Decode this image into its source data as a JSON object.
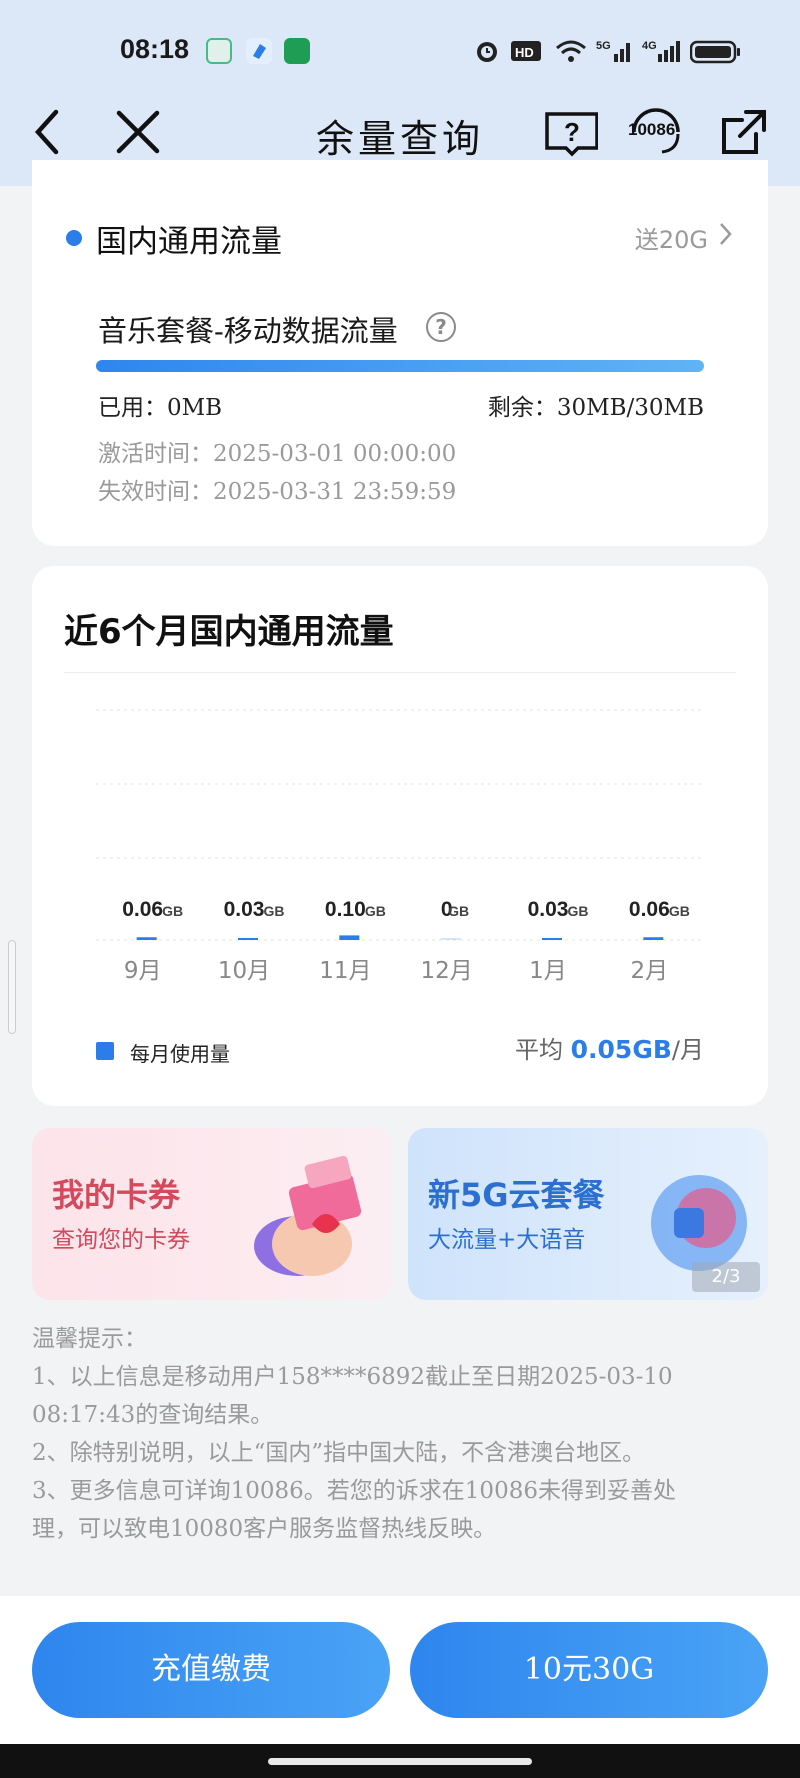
{
  "status_bar": {
    "time": "08:18",
    "right_icons": [
      "alarm-icon",
      "hd-icon",
      "wifi-icon",
      "5g-signal-icon",
      "4g-signal-icon",
      "battery-icon"
    ]
  },
  "nav": {
    "title": "余量查询",
    "back_icon": "chevron-left-icon",
    "close_icon": "close-icon",
    "help_icon": "help-book-icon",
    "service_label": "10086",
    "share_icon": "share-icon"
  },
  "traffic_card": {
    "section_title": "国内通用流量",
    "promo_link": "送20G",
    "package_name": "音乐套餐-移动数据流量",
    "help_mark": "?",
    "used": "已用：0MB",
    "remaining": "剩余：30MB/30MB",
    "remaining_fraction": 1.0,
    "activate": "激活时间：2025-03-01 00:00:00",
    "expire": "失效时间：2025-03-31 23:59:59"
  },
  "history_card": {
    "title": "近6个月国内通用流量",
    "legend": "每月使用量",
    "avg_prefix": "平均",
    "avg_value": "0.05GB",
    "avg_suffix": "/月"
  },
  "chart_data": {
    "type": "bar",
    "categories": [
      "9月",
      "10月",
      "11月",
      "12月",
      "1月",
      "2月"
    ],
    "values": [
      0.06,
      0.03,
      0.1,
      0,
      0.03,
      0.06
    ],
    "value_labels": [
      "0.06",
      "0.03",
      "0.10",
      "0",
      "0.03",
      "0.06"
    ],
    "unit": "GB",
    "series": [
      {
        "name": "每月使用量",
        "values": [
          0.06,
          0.03,
          0.1,
          0,
          0.03,
          0.06
        ]
      }
    ],
    "grid": true,
    "legend_position": "bottom-left",
    "color": "#2b7de9"
  },
  "banners": [
    {
      "title": "我的卡券",
      "subtitle": "查询您的卡券"
    },
    {
      "title": "新5G云套餐",
      "subtitle": "大流量+大语音",
      "pager": "2/3"
    }
  ],
  "tips": [
    "温馨提示：",
    "1、以上信息是移动用户158****6892截止至日期2025-03-10",
    "08:17:43的查询结果。",
    "2、除特别说明，以上“国内”指中国大陆，不含港澳台地区。",
    "3、更多信息可详询10086。若您的诉求在10086未得到妥善处",
    "理，可以致电10080客户服务监督热线反映。"
  ],
  "footer": {
    "recharge": "充值缴费",
    "offer": "10元30G"
  },
  "colors": {
    "accent": "#2b7de9",
    "header_bg": "#dce8f7",
    "page_bg": "#f2f3f5"
  }
}
